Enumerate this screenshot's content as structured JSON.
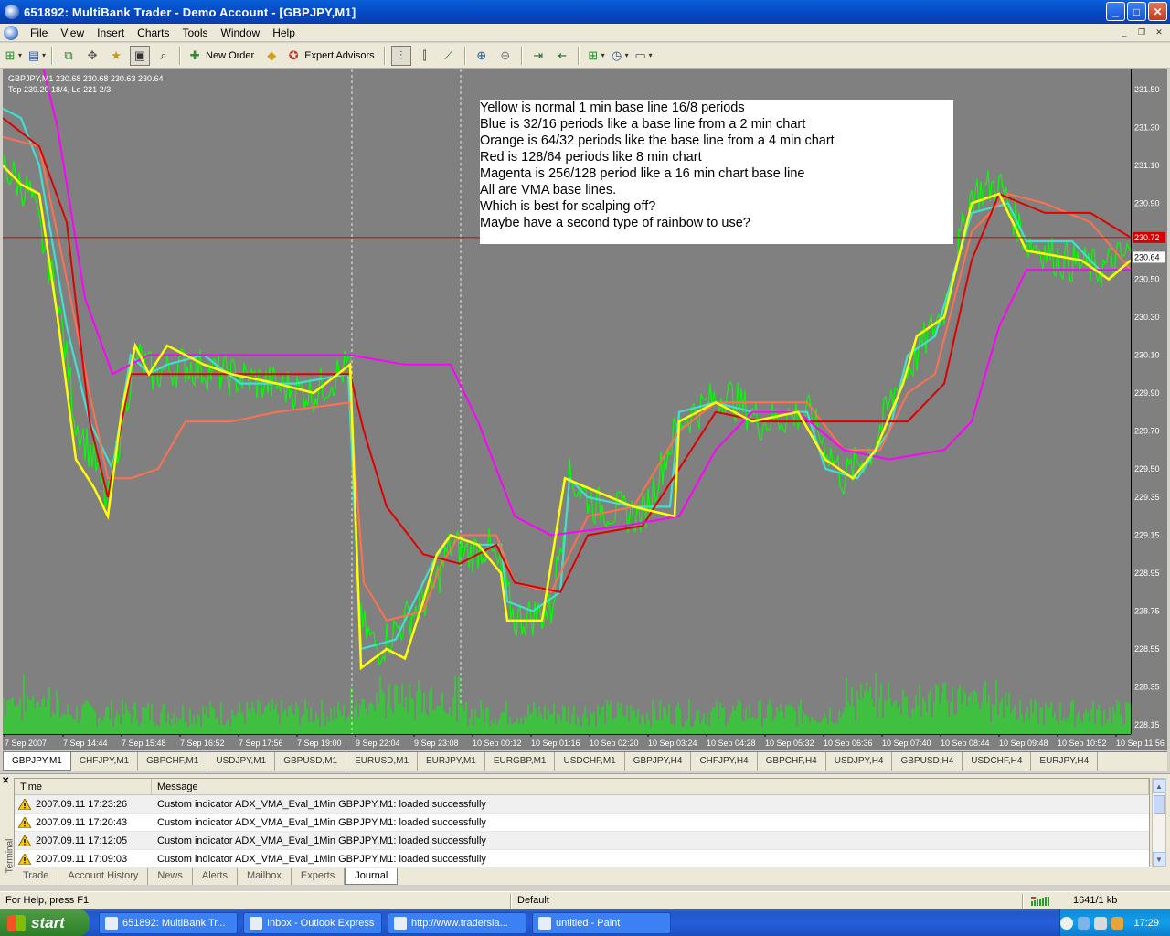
{
  "window": {
    "title": "651892: MultiBank Trader - Demo Account - [GBPJPY,M1]"
  },
  "menu": [
    "File",
    "View",
    "Insert",
    "Charts",
    "Tools",
    "Window",
    "Help"
  ],
  "toolbar": {
    "new_order": "New Order",
    "expert_advisors": "Expert Advisors"
  },
  "chart": {
    "info_line1": "GBPJPY,M1  230.68 230.68 230.63 230.64",
    "info_line2": "Top 239.20 18/4, Lo 221 2/3",
    "notes": [
      "Yellow is normal 1 min base line 16/8 periods",
      "Blue is 32/16 periods like a base line from a 2 min chart",
      "Orange is 64/32 periods like the base line from a 4 min chart",
      "Red is 128/64 periods like 8 min chart",
      "Magenta is 256/128 period like a 16 min chart base line",
      "All are VMA base lines.",
      "Which is best for scalping off?",
      "Maybe have a second type of rainbow to use?"
    ],
    "price_labels": [
      "231.50",
      "231.30",
      "231.10",
      "230.90",
      "230.50",
      "230.30",
      "230.10",
      "229.90",
      "229.70",
      "229.50",
      "229.35",
      "229.15",
      "228.95",
      "228.75",
      "228.55",
      "228.35",
      "228.15"
    ],
    "current_price": "230.64",
    "red_level_price": "230.72",
    "time_labels": [
      "7 Sep 2007",
      "7 Sep 14:44",
      "7 Sep 15:48",
      "7 Sep 16:52",
      "7 Sep 17:56",
      "7 Sep 19:00",
      "9 Sep 22:04",
      "9 Sep 23:08",
      "10 Sep 00:12",
      "10 Sep 01:16",
      "10 Sep 02:20",
      "10 Sep 03:24",
      "10 Sep 04:28",
      "10 Sep 05:32",
      "10 Sep 06:36",
      "10 Sep 07:40",
      "10 Sep 08:44",
      "10 Sep 09:48",
      "10 Sep 10:52",
      "10 Sep 11:56"
    ],
    "colors": {
      "background": "#808080",
      "price": "#00ff00",
      "yellow": "#ffff00",
      "blue": "#40e0d0",
      "orange": "#ff7050",
      "red": "#e00000",
      "magenta": "#ff00ff"
    }
  },
  "chart_tabs": [
    "GBPJPY,M1",
    "CHFJPY,M1",
    "GBPCHF,M1",
    "USDJPY,M1",
    "GBPUSD,M1",
    "EURUSD,M1",
    "EURJPY,M1",
    "EURGBP,M1",
    "USDCHF,M1",
    "GBPJPY,H4",
    "CHFJPY,H4",
    "GBPCHF,H4",
    "USDJPY,H4",
    "GBPUSD,H4",
    "USDCHF,H4",
    "EURJPY,H4"
  ],
  "terminal": {
    "side_label": "Terminal",
    "headers": [
      "Time",
      "Message"
    ],
    "rows": [
      {
        "time": "2007.09.11 17:23:26",
        "message": "Custom indicator ADX_VMA_Eval_1Min GBPJPY,M1: loaded successfully"
      },
      {
        "time": "2007.09.11 17:20:43",
        "message": "Custom indicator ADX_VMA_Eval_1Min GBPJPY,M1: loaded successfully"
      },
      {
        "time": "2007.09.11 17:12:05",
        "message": "Custom indicator ADX_VMA_Eval_1Min GBPJPY,M1: loaded successfully"
      },
      {
        "time": "2007.09.11 17:09:03",
        "message": "Custom indicator ADX_VMA_Eval_1Min GBPJPY,M1: loaded successfully"
      }
    ],
    "tabs": [
      "Trade",
      "Account History",
      "News",
      "Alerts",
      "Mailbox",
      "Experts",
      "Journal"
    ]
  },
  "status": {
    "help": "For Help, press F1",
    "profile": "Default",
    "traffic": "1641/1 kb"
  },
  "taskbar": {
    "start": "start",
    "tasks": [
      "651892: MultiBank Tr...",
      "Inbox - Outlook Express",
      "http://www.tradersla...",
      "untitled - Paint"
    ],
    "clock": "17:29"
  }
}
